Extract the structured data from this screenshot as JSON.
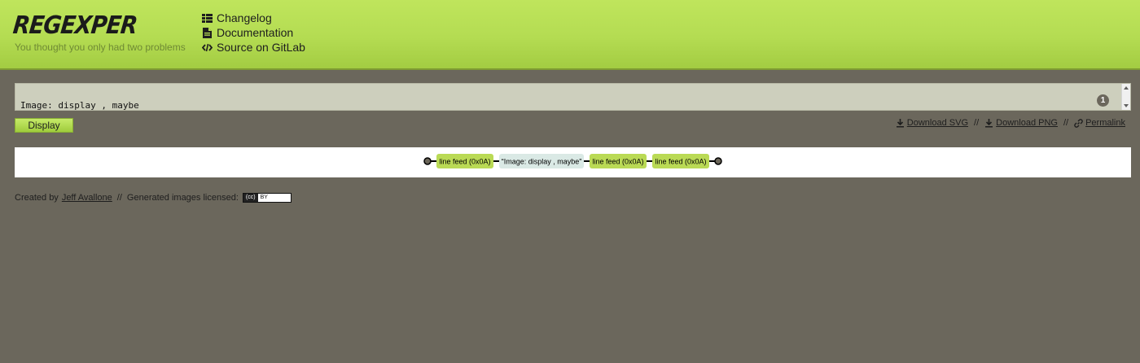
{
  "header": {
    "logo": "REGEXPER",
    "tagline": "You thought you only had two problems",
    "nav": [
      {
        "label": "Changelog",
        "icon": "list-icon"
      },
      {
        "label": "Documentation",
        "icon": "document-icon"
      },
      {
        "label": "Source on GitLab",
        "icon": "code-icon"
      }
    ]
  },
  "input": {
    "value": "Image: display , maybe",
    "line_count": "1"
  },
  "actions": {
    "display_label": "Display",
    "download_svg": "Download SVG",
    "download_png": "Download PNG",
    "permalink": "Permalink",
    "separator": "//"
  },
  "diagram": {
    "nodes": [
      {
        "type": "start"
      },
      {
        "type": "escape",
        "label": "line feed (0x0A)"
      },
      {
        "type": "literal",
        "label": "“Image: display , maybe”"
      },
      {
        "type": "escape",
        "label": "line feed (0x0A)"
      },
      {
        "type": "escape",
        "label": "line feed (0x0A)"
      },
      {
        "type": "end"
      }
    ],
    "colors": {
      "escape": "#bada55",
      "literal": "#dae9e5",
      "terminal": "#6b6659"
    }
  },
  "footer": {
    "created_by": "Created by",
    "author": "Jeff Avallone",
    "separator": "//",
    "license_text": "Generated images licensed:",
    "cc_left": "(cc)",
    "cc_right": "BY"
  }
}
